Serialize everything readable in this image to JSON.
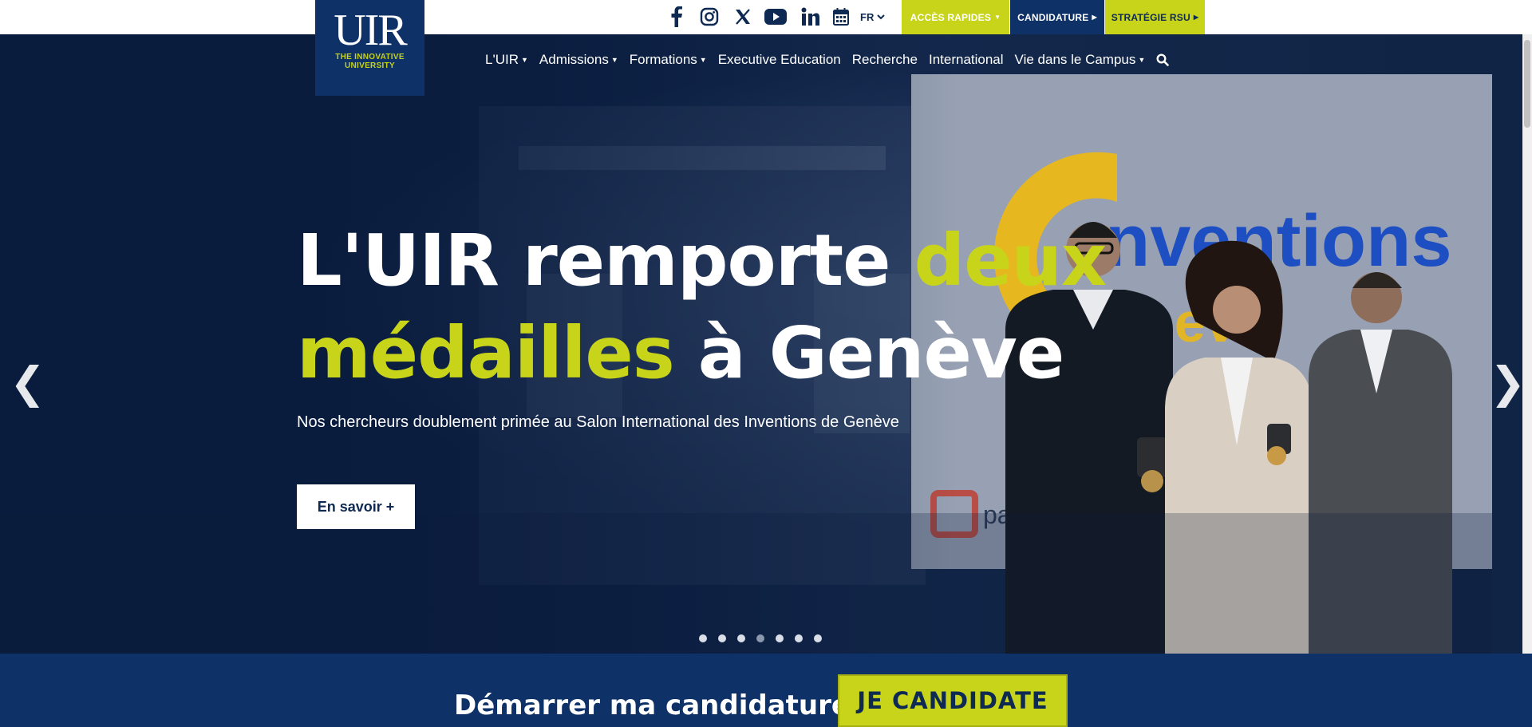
{
  "brand": {
    "logo_letters": "UIR",
    "tagline": "THE INNOVATIVE UNIVERSITY"
  },
  "topbar": {
    "social": [
      {
        "name": "facebook-icon"
      },
      {
        "name": "instagram-icon"
      },
      {
        "name": "x-icon"
      },
      {
        "name": "youtube-icon"
      },
      {
        "name": "linkedin-icon"
      },
      {
        "name": "calendar-icon"
      }
    ],
    "language": "FR",
    "quick_access": "ACCÈS RAPIDES",
    "apply": "CANDIDATURE",
    "rsu": "STRATÉGIE RSU",
    "colors": {
      "accent": "#c8d41a",
      "navy": "#0e3168"
    }
  },
  "nav": {
    "items": [
      {
        "label": "L'UIR",
        "dropdown": true
      },
      {
        "label": "Admissions",
        "dropdown": true
      },
      {
        "label": "Formations",
        "dropdown": true
      },
      {
        "label": "Executive Education",
        "dropdown": false
      },
      {
        "label": "Recherche",
        "dropdown": false
      },
      {
        "label": "International",
        "dropdown": false
      },
      {
        "label": "Vie dans le Campus",
        "dropdown": true
      }
    ],
    "search_icon": "search-icon"
  },
  "hero": {
    "headline_part1": "L'UIR remporte ",
    "headline_part2": "deux",
    "headline_part3": "médailles",
    "headline_part4": " à Genève",
    "subtitle": "Nos chercheurs doublement primée au Salon International des Inventions de Genève",
    "cta": "En savoir +",
    "prev": "❮",
    "next": "❯",
    "slides_total": 7,
    "active_slide": 4,
    "banner_text": "nventions",
    "banner_sub": "eneve",
    "sponsor_text": "pale"
  },
  "apply_bar": {
    "text": "Démarrer ma candidature",
    "button": "JE CANDIDATE"
  }
}
